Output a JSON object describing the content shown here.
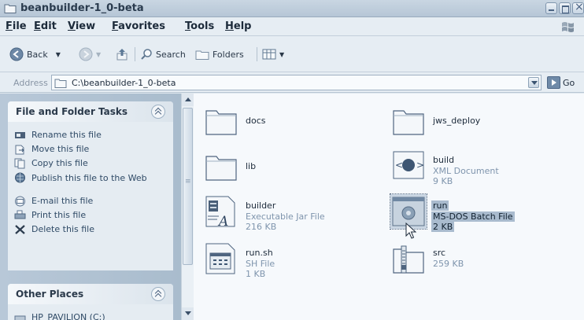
{
  "window": {
    "title": "beanbuilder-1_0-beta"
  },
  "menu": [
    "File",
    "Edit",
    "View",
    "Favorites",
    "Tools",
    "Help"
  ],
  "toolbar": {
    "back_label": "Back",
    "search_label": "Search",
    "folders_label": "Folders"
  },
  "address": {
    "label": "Address",
    "path": "C:\\beanbuilder-1_0-beta",
    "go_label": "Go"
  },
  "taskpane": {
    "file_tasks": {
      "title": "File and Folder Tasks",
      "items": [
        {
          "label": "Rename this file",
          "icon": "rename-icon"
        },
        {
          "label": "Move this file",
          "icon": "move-icon"
        },
        {
          "label": "Copy this file",
          "icon": "copy-icon"
        },
        {
          "label": "Publish this file to the Web",
          "icon": "publish-web-icon"
        },
        {
          "label": "E-mail this file",
          "icon": "email-icon"
        },
        {
          "label": "Print this file",
          "icon": "print-icon"
        },
        {
          "label": "Delete this file",
          "icon": "delete-icon"
        }
      ]
    },
    "other_places": {
      "title": "Other Places",
      "first_item": "HP_PAVILION (C:)"
    }
  },
  "files": [
    {
      "name": "docs",
      "type": "",
      "size": "",
      "icon": "folder-icon"
    },
    {
      "name": "jws_deploy",
      "type": "",
      "size": "",
      "icon": "folder-icon"
    },
    {
      "name": "lib",
      "type": "",
      "size": "",
      "icon": "folder-icon"
    },
    {
      "name": "build",
      "type": "XML Document",
      "size": "9 KB",
      "icon": "xml-document-icon"
    },
    {
      "name": "builder",
      "type": "Executable Jar File",
      "size": "216 KB",
      "icon": "jar-file-icon"
    },
    {
      "name": "run",
      "type": "MS-DOS Batch File",
      "size": "2 KB",
      "icon": "batch-file-icon",
      "selected": true
    },
    {
      "name": "run.sh",
      "type": "SH File",
      "size": "1 KB",
      "icon": "sh-file-icon"
    },
    {
      "name": "src",
      "type": "",
      "size": "259 KB",
      "icon": "zip-folder-icon"
    }
  ]
}
